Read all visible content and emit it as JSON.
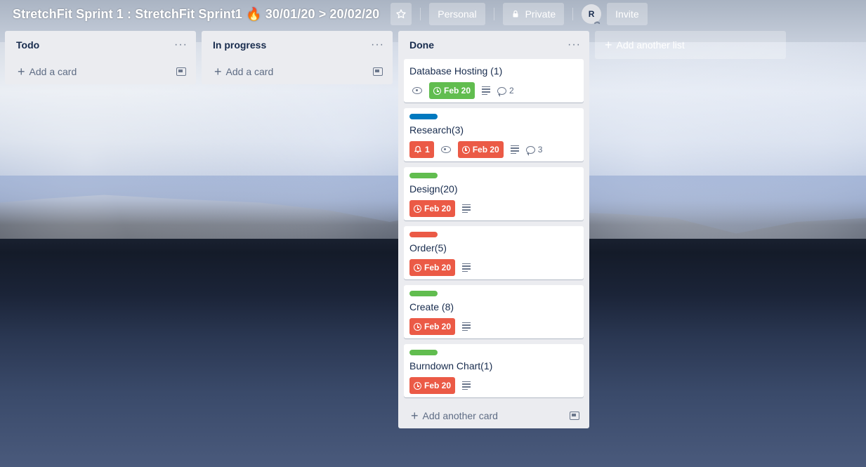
{
  "board": {
    "title": "StretchFit Sprint 1 : StretchFit Sprint1 🔥 30/01/20 > 20/02/20",
    "visibility_team": "Personal",
    "visibility_privacy": "Private",
    "member_initial": "R",
    "invite_label": "Invite"
  },
  "lists": [
    {
      "title": "Todo",
      "add_card_label": "Add a card"
    },
    {
      "title": "In progress",
      "add_card_label": "Add a card"
    },
    {
      "title": "Done",
      "add_card_label": "Add another card",
      "cards": [
        {
          "title": "Database Hosting (1)",
          "due": "Feb 20",
          "due_status": "complete",
          "comments": "2"
        },
        {
          "title": "Research(3)",
          "label_color": "#0079bf",
          "notifications": "1",
          "due": "Feb 20",
          "due_status": "overdue",
          "comments": "3"
        },
        {
          "title": "Design(20)",
          "label_color": "#61bd4f",
          "due": "Feb 20",
          "due_status": "overdue"
        },
        {
          "title": "Order(5)",
          "label_color": "#eb5a46",
          "due": "Feb 20",
          "due_status": "overdue"
        },
        {
          "title": "Create (8)",
          "label_color": "#61bd4f",
          "due": "Feb 20",
          "due_status": "overdue"
        },
        {
          "title": "Burndown Chart(1)",
          "label_color": "#61bd4f",
          "due": "Feb 20",
          "due_status": "overdue"
        }
      ]
    }
  ],
  "add_list_label": "Add another list",
  "icons": {
    "star": "star-icon",
    "lock": "lock-icon",
    "menu": "more-horizontal-icon",
    "template": "card-template-icon",
    "watch": "eye-icon",
    "clock": "clock-icon",
    "description": "description-icon",
    "comment": "comment-icon",
    "bell": "bell-icon"
  },
  "colors": {
    "due_overdue": "#eb5a46",
    "due_complete": "#61bd4f",
    "list_bg": "#ebecf0"
  }
}
